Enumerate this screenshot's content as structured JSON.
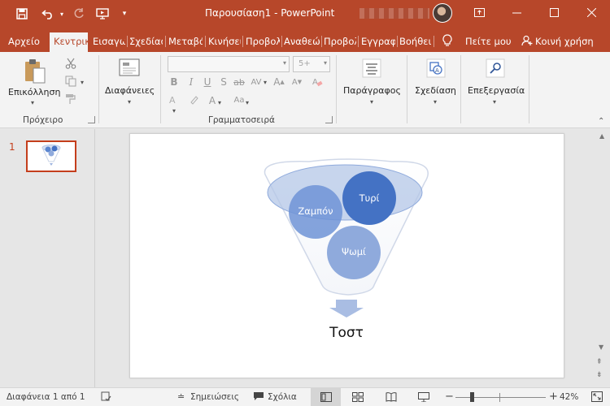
{
  "titlebar": {
    "title": "Παρουσίαση1  -  PowerPoint",
    "quick_access": {
      "save_icon": "save-icon",
      "undo_icon": "undo-icon",
      "redo_icon": "redo-icon",
      "present_icon": "present-from-beginning-icon",
      "customize_icon": "customize-toolbar-icon"
    },
    "window_buttons": {
      "ribbon_options": "ribbon-display-options-icon",
      "minimize": "minimize-icon",
      "maximize": "maximize-icon",
      "close": "close-icon"
    }
  },
  "tabs": [
    {
      "label": "Αρχείο",
      "active": false
    },
    {
      "label": "Κεντρική",
      "active": true
    },
    {
      "label": "Εισαγωγή",
      "active": false
    },
    {
      "label": "Σχεδίαση",
      "active": false
    },
    {
      "label": "Μεταβάσεις",
      "active": false
    },
    {
      "label": "Κινήσεις",
      "active": false
    },
    {
      "label": "Προβολή",
      "active": false
    },
    {
      "label": "Αναθεώρηση",
      "active": false
    },
    {
      "label": "Προβολή",
      "active": false
    },
    {
      "label": "Εγγραφή",
      "active": false
    },
    {
      "label": "Βοήθεια",
      "active": false
    }
  ],
  "tell_me": "Πείτε μου",
  "share": "Κοινή χρήση",
  "ribbon": {
    "clipboard": {
      "paste_label": "Επικόλληση",
      "group_label": "Πρόχειρο"
    },
    "slides": {
      "label": "Διαφάνειες"
    },
    "font": {
      "font_name": "",
      "font_size": "5+",
      "group_label": "Γραμματοσειρά"
    },
    "paragraph": {
      "label": "Παράγραφος"
    },
    "design": {
      "label": "Σχεδίαση"
    },
    "editing": {
      "label": "Επεξεργασία"
    }
  },
  "thumbnail": {
    "number": "1"
  },
  "slide": {
    "funnel": {
      "items": [
        "Ζαμπόν",
        "Τυρί",
        "Ψωμί"
      ],
      "result": "Τοστ",
      "colors": {
        "dark": "#4472c4",
        "light": "#8faadc",
        "rim": "#b4c7e7",
        "outline": "#d0d8e8"
      }
    }
  },
  "status": {
    "slide_info": "Διαφάνεια 1 από 1",
    "notes": "Σημειώσεις",
    "comments": "Σχόλια",
    "zoom": "42%"
  }
}
